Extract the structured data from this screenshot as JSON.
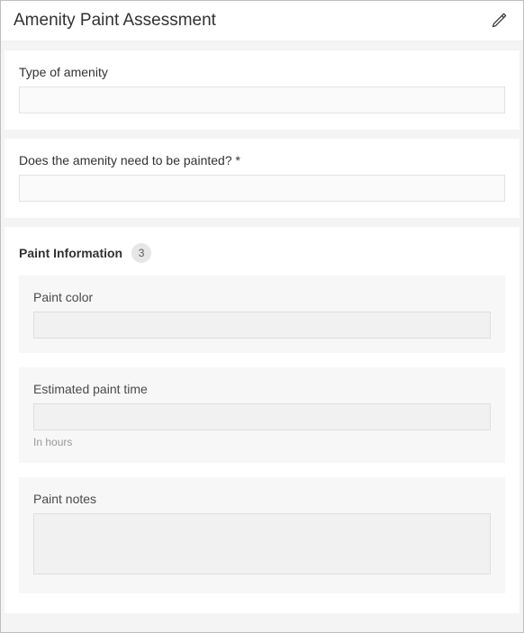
{
  "header": {
    "title": "Amenity Paint Assessment"
  },
  "questions": {
    "amenity_type": {
      "label": "Type of amenity",
      "value": ""
    },
    "needs_paint": {
      "label": "Does the amenity need to be painted? *",
      "value": ""
    }
  },
  "group": {
    "title": "Paint Information",
    "count": "3",
    "paint_color": {
      "label": "Paint color",
      "value": ""
    },
    "paint_time": {
      "label": "Estimated paint time",
      "value": "",
      "hint": "In hours"
    },
    "paint_notes": {
      "label": "Paint notes",
      "value": ""
    }
  }
}
